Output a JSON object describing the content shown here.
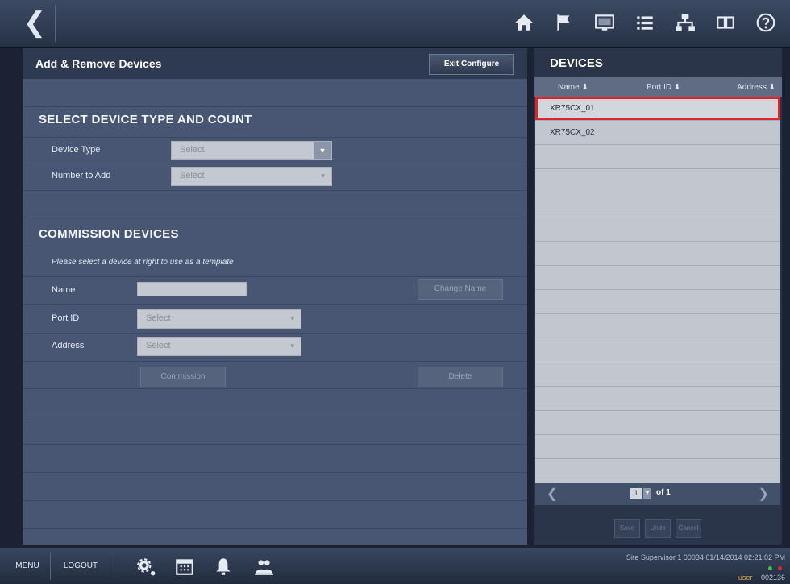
{
  "header": {
    "back_icon": "chevron-left-icon",
    "icons": [
      "home-icon",
      "flag-icon",
      "monitor-icon",
      "list-icon",
      "network-icon",
      "panels-icon",
      "help-icon"
    ]
  },
  "left_panel": {
    "title": "Add & Remove Devices",
    "exit_button": "Exit Configure",
    "section1": {
      "title": "SELECT DEVICE TYPE AND COUNT",
      "device_type_label": "Device Type",
      "device_type_value": "Select",
      "number_label": "Number to Add",
      "number_value": "Select"
    },
    "section2": {
      "title": "COMMISSION DEVICES",
      "hint": "Please select a device at right to use as a template",
      "name_label": "Name",
      "name_value": "",
      "change_name_button": "Change Name",
      "port_label": "Port ID",
      "port_value": "Select",
      "address_label": "Address",
      "address_value": "Select",
      "commission_button": "Commission",
      "delete_button": "Delete"
    }
  },
  "right_panel": {
    "title": "DEVICES",
    "columns": [
      "Name ⬍",
      "Port ID ⬍",
      "Address ⬍"
    ],
    "rows": [
      "XR75CX_01",
      "XR75CX_02"
    ],
    "page_value": "1",
    "page_of": "of 1",
    "buttons": [
      "Save",
      "Undo",
      "Cancel"
    ]
  },
  "footer": {
    "menu": "MENU",
    "logout": "LOGOUT",
    "icons": [
      "gear-icon",
      "calendar-icon",
      "bell-icon",
      "users-icon"
    ],
    "status": "Site Supervisor 1 00034 01/14/2014 02:21:02 PM",
    "user": "user",
    "user_id": "002136",
    "colors": {
      "ok": "#3fbf4a",
      "alarm": "#e02428"
    }
  }
}
